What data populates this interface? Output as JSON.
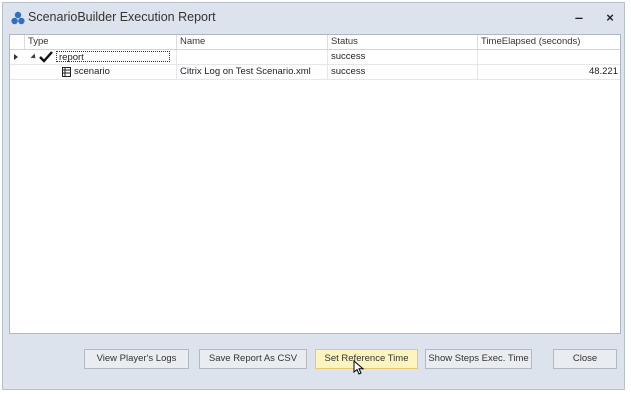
{
  "window": {
    "title": "ScenarioBuilder Execution Report",
    "minimize_glyph": "‒",
    "close_glyph": "×",
    "icon": "scenario-builder-app-icon"
  },
  "grid": {
    "columns": [
      "Type",
      "Name",
      "Status",
      "TimeElapsed (seconds)"
    ],
    "rows": [
      {
        "type": "report",
        "name": "",
        "status": "success",
        "time": "",
        "icon": "check-icon",
        "expanded": true,
        "current": true
      },
      {
        "type": "scenario",
        "name": "Citrix Log on Test Scenario.xml",
        "status": "success",
        "time": "48.221",
        "icon": "scenario-file-icon"
      }
    ]
  },
  "buttons": {
    "view_logs": "View Player's Logs",
    "save_csv": "Save Report As CSV",
    "set_reference": "Set Reference Time",
    "show_steps": "Show Steps Exec. Time",
    "close": "Close"
  },
  "colors": {
    "window_bg": "#dde3ec",
    "hover_button": "#fdf4bf"
  }
}
